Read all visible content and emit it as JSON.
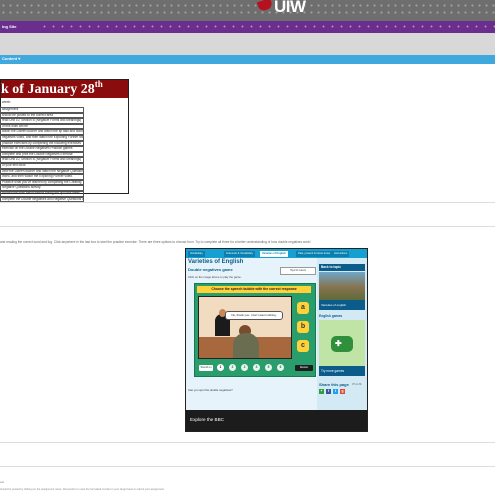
{
  "header": {
    "logo_text": "UIW",
    "site_title": "ing Site",
    "menu_item": "Content ▾"
  },
  "week": {
    "title": "k of January 28",
    "title_sup": "th",
    "subtitle": "week:",
    "tasks": [
      "assignment",
      "should be posted to the correct area",
      "read Unit 10, Section B (Negative Forms and Meanings)",
      "of this work will be",
      "watch the Ucleen Ascher and watch the tip task and double",
      "negatives video, and then watch the Exploring Further video.",
      "practice exercises by completing the following exercises",
      "exercise on the Double Negatives Practice games",
      "complete and print the Double Negatives Exercise",
      "read Unit 10, Section B (Negative Forms and Meanings)",
      "of your text book",
      "view the Ucleen Ascher and watch the Negative Questions",
      "video, and then watch the Exploring Further video.",
      "Practice what you've learned by completing the Creating",
      "Negative Questions activity.",
      "Review the links below before taking the quiz this week",
      "complete the Double Negatives and Negative Questions quiz"
    ]
  },
  "instructions_text": "and reading the correct word and fog. Click anywhere in the last box to start the practice exercise. There are three options to choose from. Try to complete all three for a better understanding of how double negatives work!",
  "game": {
    "tabs": [
      "Vocabulary",
      "Grammar & Vocabulary",
      "Varieties of English",
      "Past, present & future tense",
      "Instructions"
    ],
    "active_tab": 2,
    "title": "Varieties of English",
    "subtitle": "Double negatives game",
    "hint": "Click on the image above to play the game.",
    "tips_button": "Tips for tutors",
    "instruction": "Choose the speech bubble with the correct response",
    "speech": "No, thank you. I don't want nothing.",
    "choices": [
      "a",
      "b",
      "c"
    ],
    "mute_label": "Sound on",
    "question_numbers": [
      "1",
      "2",
      "3",
      "4",
      "5",
      "6"
    ],
    "active_question": 0,
    "restart_label": "Restart",
    "spot_text": "Can you spot the double negatives?",
    "back_label": "Back to topic",
    "side_caption1": "Varieties of english",
    "side_label2": "English games",
    "side_caption2": "Try more games",
    "share_title": "Share this page",
    "share_sub": "37 on fb",
    "share_icons": [
      "+",
      "f",
      "t",
      "g"
    ],
    "footer_text": "Explore the BBC"
  },
  "footer": {
    "note1": "ask",
    "note2": "should be posted by clicking on the assignment name. Remember to meet the formatted number in your target have to submit your assignment"
  },
  "colors": {
    "brand_red": "#8b0c0c",
    "purple_bar": "#6a2f8e",
    "blue_bar": "#3fa9dd",
    "bbc_blue": "#0b5c8a",
    "stage_green": "#2a9d6c"
  }
}
